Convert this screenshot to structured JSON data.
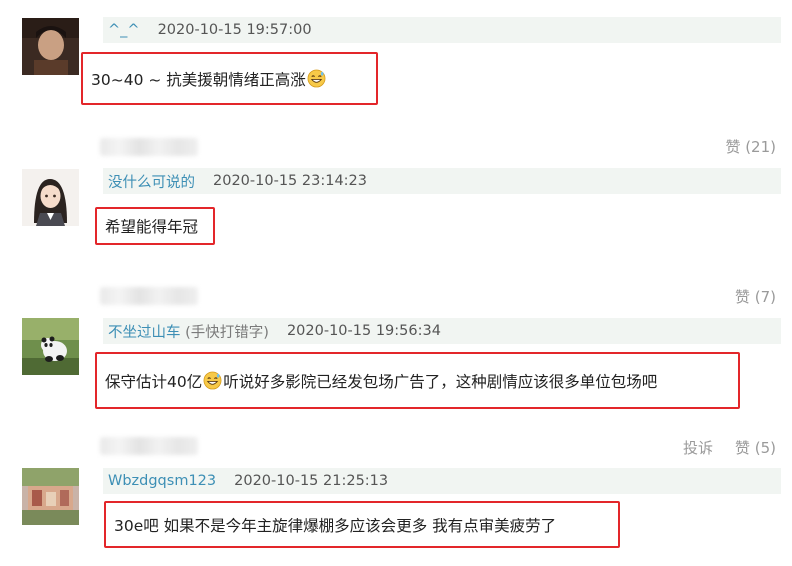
{
  "comments": [
    {
      "username": "^_^",
      "username_suffix": "",
      "timestamp": "2020-10-15 19:57:00",
      "content_before": "30~40 ~ 抗美援朝情绪正高涨",
      "emoji": "grinning-sweat-emoji",
      "content_after": ""
    },
    {
      "username": "没什么可说的",
      "username_suffix": "",
      "timestamp": "2020-10-15 23:14:23",
      "content_before": "希望能得年冠",
      "emoji": "",
      "content_after": ""
    },
    {
      "username": "不坐过山车",
      "username_suffix": " (手快打错字)",
      "timestamp": "2020-10-15 19:56:34",
      "content_before": "保守估计40亿",
      "emoji": "grinning-sweat-emoji",
      "content_after": "听说好多影院已经发包场广告了，这种剧情应该很多单位包场吧"
    },
    {
      "username": "Wbzdgqsm123",
      "username_suffix": "",
      "timestamp": "2020-10-15 21:25:13",
      "content_before": "30e吧 如果不是今年主旋律爆棚多应该会更多 我有点审美疲劳了",
      "emoji": "",
      "content_after": ""
    }
  ],
  "footers": [
    {
      "report_label": "",
      "like_label": "赞 (21)"
    },
    {
      "report_label": "",
      "like_label": "赞 (7)"
    },
    {
      "report_label": "投诉",
      "like_label": "赞 (5)"
    }
  ],
  "colors": {
    "highlight_border": "#e3262a",
    "username": "#3d8fb5",
    "header_bg": "#f1f5f2"
  }
}
